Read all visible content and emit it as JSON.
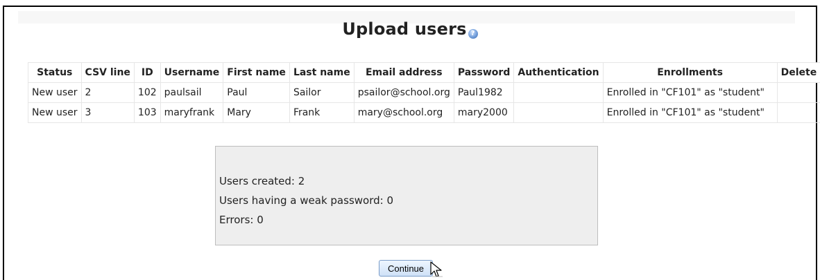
{
  "page": {
    "title": "Upload users",
    "help_icon": "help-icon",
    "continue_label": "Continue"
  },
  "table": {
    "headers": [
      "Status",
      "CSV line",
      "ID",
      "Username",
      "First name",
      "Last name",
      "Email address",
      "Password",
      "Authentication",
      "Enrollments",
      "Delete"
    ],
    "rows": [
      [
        "New user",
        "2",
        "102",
        "paulsail",
        "Paul",
        "Sailor",
        "psailor@school.org",
        "Paul1982",
        "",
        "Enrolled in \"CF101\" as \"student\"",
        ""
      ],
      [
        "New user",
        "3",
        "103",
        "maryfrank",
        "Mary",
        "Frank",
        "mary@school.org",
        "mary2000",
        "",
        "Enrolled in \"CF101\" as \"student\"",
        ""
      ]
    ]
  },
  "summary": {
    "users_created": "Users created: 2",
    "weak_password": "Users having a weak password: 0",
    "errors": "Errors: 0"
  }
}
